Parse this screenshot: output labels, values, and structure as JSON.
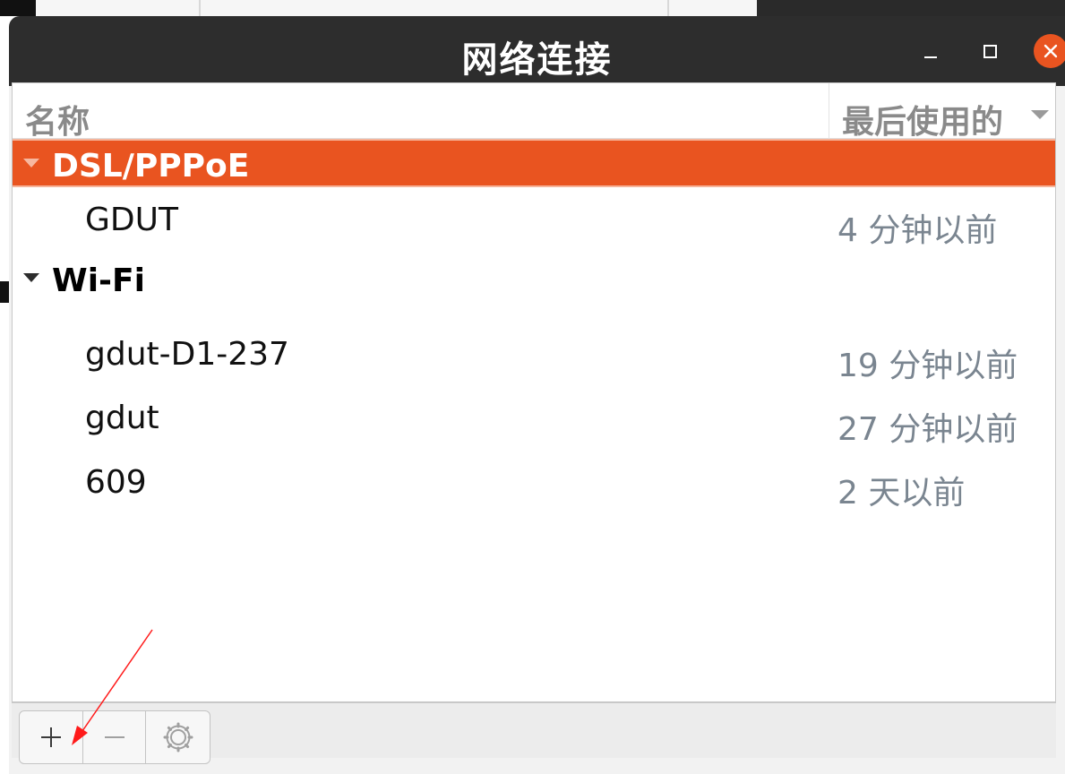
{
  "window": {
    "title": "网络连接"
  },
  "columns": {
    "name": "名称",
    "last_used": "最后使用的"
  },
  "groups": [
    {
      "label": "DSL/PPPoE",
      "selected": true,
      "items": [
        {
          "name": "GDUT",
          "time": "4 分钟以前"
        }
      ]
    },
    {
      "label": "Wi-Fi",
      "selected": false,
      "items": [
        {
          "name": "gdut-D1-237",
          "time": "19 分钟以前"
        },
        {
          "name": "gdut",
          "time": "27 分钟以前"
        },
        {
          "name": "609",
          "time": "2 天以前"
        }
      ]
    }
  ],
  "toolbar": {
    "add_icon": "plus-icon",
    "remove_icon": "minus-icon",
    "settings_icon": "gear-icon"
  },
  "colors": {
    "accent": "#e95420",
    "titlebar": "#2d2d2d",
    "secondary_text": "#7a8590"
  }
}
